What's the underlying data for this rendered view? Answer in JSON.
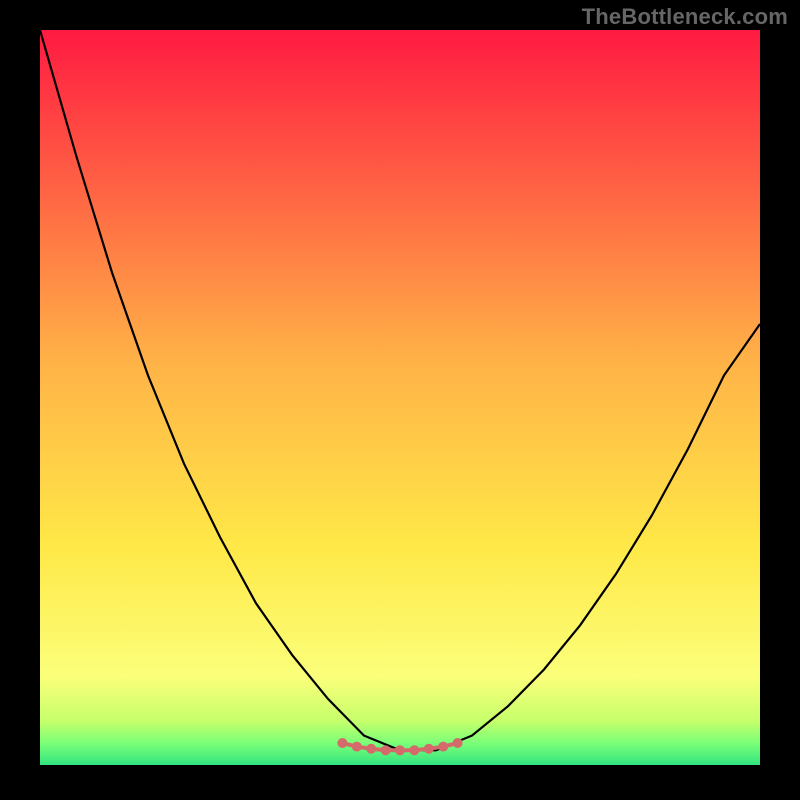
{
  "watermark": "TheBottleneck.com",
  "chart_data": {
    "type": "line",
    "title": "",
    "xlabel": "",
    "ylabel": "",
    "x": [
      0.0,
      0.05,
      0.1,
      0.15,
      0.2,
      0.25,
      0.3,
      0.35,
      0.4,
      0.45,
      0.5,
      0.55,
      0.6,
      0.65,
      0.7,
      0.75,
      0.8,
      0.85,
      0.9,
      0.95,
      1.0
    ],
    "series": [
      {
        "name": "curve",
        "values": [
          1.0,
          0.83,
          0.67,
          0.53,
          0.41,
          0.31,
          0.22,
          0.15,
          0.09,
          0.04,
          0.02,
          0.02,
          0.04,
          0.08,
          0.13,
          0.19,
          0.26,
          0.34,
          0.43,
          0.53,
          0.6
        ]
      }
    ],
    "highlight": {
      "name": "basin-markers",
      "x": [
        0.42,
        0.44,
        0.46,
        0.48,
        0.5,
        0.52,
        0.54,
        0.56,
        0.58
      ],
      "y": [
        0.03,
        0.025,
        0.022,
        0.02,
        0.02,
        0.02,
        0.022,
        0.025,
        0.03
      ]
    },
    "xlim": [
      0,
      1
    ],
    "ylim": [
      0,
      1
    ],
    "background": {
      "type": "vertical-gradient",
      "stops": [
        {
          "pos": 0.0,
          "color": "#ff1a41"
        },
        {
          "pos": 0.45,
          "color": "#ffb247"
        },
        {
          "pos": 0.7,
          "color": "#ffe847"
        },
        {
          "pos": 0.88,
          "color": "#fbff7a"
        },
        {
          "pos": 0.94,
          "color": "#c6ff6b"
        },
        {
          "pos": 0.97,
          "color": "#7bff78"
        },
        {
          "pos": 1.0,
          "color": "#32e47f"
        }
      ]
    }
  }
}
